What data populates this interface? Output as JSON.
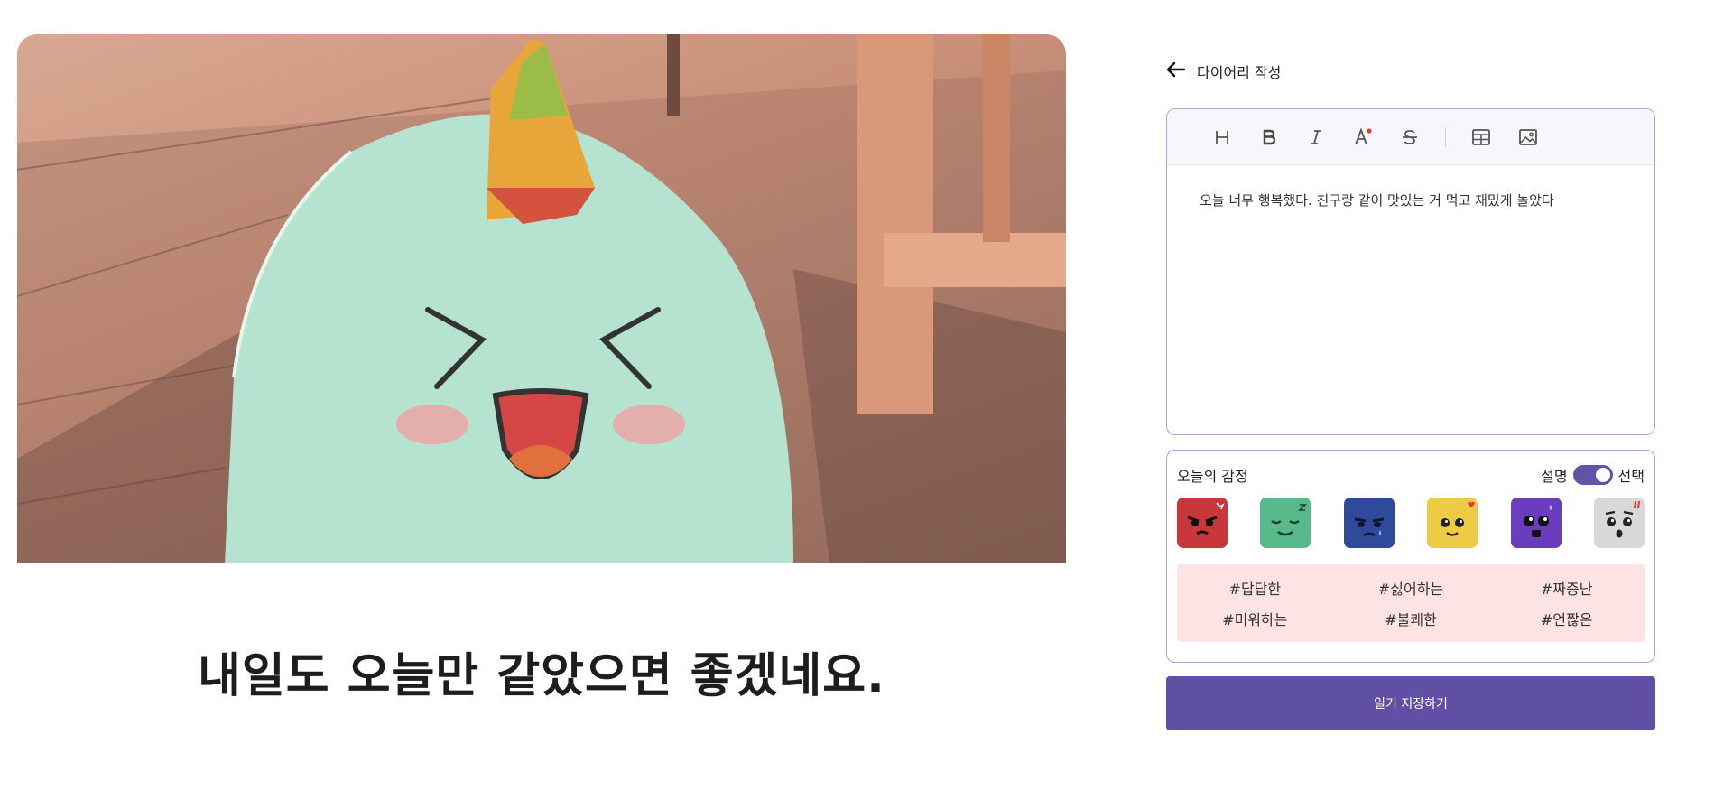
{
  "header": {
    "back_label": "다이어리 작성"
  },
  "editor": {
    "toolbar": [
      {
        "name": "heading-icon"
      },
      {
        "name": "bold-icon"
      },
      {
        "name": "italic-icon"
      },
      {
        "name": "text-color-icon"
      },
      {
        "name": "strikethrough-icon"
      },
      {
        "name": "table-icon"
      },
      {
        "name": "image-icon"
      }
    ],
    "content": "오늘 너무 행복했다. 친구랑 같이 맛있는 거 먹고 재밌게 놀았다"
  },
  "emotion": {
    "title": "오늘의 감정",
    "toggle_left": "설명",
    "toggle_right": "선택",
    "faces": [
      {
        "name": "angry-face-icon",
        "color": "#c8373a"
      },
      {
        "name": "content-face-icon",
        "color": "#58b98a"
      },
      {
        "name": "sad-face-icon",
        "color": "#2f4a9a"
      },
      {
        "name": "happy-face-icon",
        "color": "#eecb45"
      },
      {
        "name": "fear-face-icon",
        "color": "#6a3dbe"
      },
      {
        "name": "surprised-face-icon",
        "color": "#d8d8d8"
      }
    ],
    "tags": [
      "#답답한",
      "#싫어하는",
      "#짜증난",
      "#미워하는",
      "#불쾌한",
      "#언짢은"
    ]
  },
  "save_label": "일기 저장하기",
  "caption": "내일도 오늘만 같았으면 좋겠네요."
}
